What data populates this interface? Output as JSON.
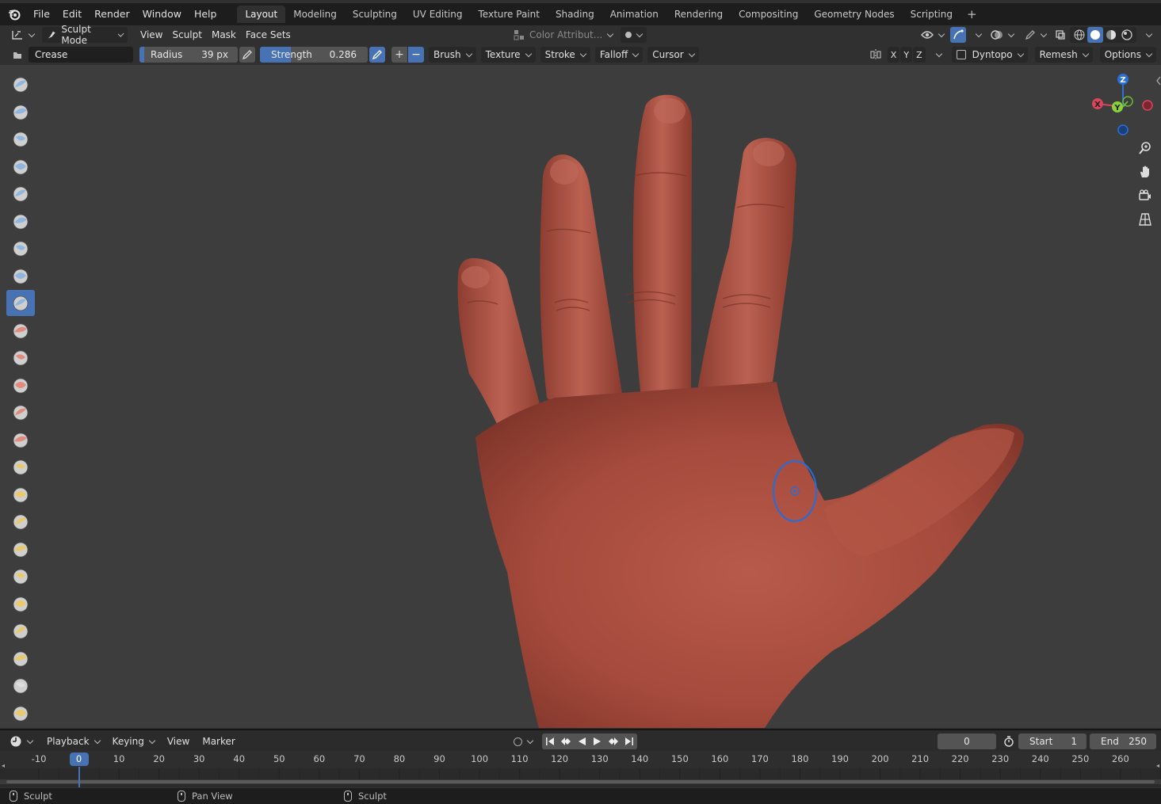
{
  "topbar": {
    "menus": [
      "File",
      "Edit",
      "Render",
      "Window",
      "Help"
    ],
    "workspaces": [
      "Layout",
      "Modeling",
      "Sculpting",
      "UV Editing",
      "Texture Paint",
      "Shading",
      "Animation",
      "Rendering",
      "Compositing",
      "Geometry Nodes",
      "Scripting"
    ],
    "add_label": "+"
  },
  "header": {
    "mode": "Sculpt Mode",
    "menus": [
      "View",
      "Sculpt",
      "Mask",
      "Face Sets"
    ],
    "color_attribute": "Color Attribut..."
  },
  "tool_settings": {
    "brush_name": "Crease",
    "radius_label": "Radius",
    "radius_value": "39 px",
    "strength_label": "Strength",
    "strength_value": "0.286",
    "strength_fraction": 0.286,
    "plus": "+",
    "minus": "−",
    "dropdowns": [
      "Brush",
      "Texture",
      "Stroke",
      "Falloff",
      "Cursor"
    ],
    "axes": [
      "X",
      "Y",
      "Z"
    ],
    "dyntopo": "Dyntopo",
    "remesh": "Remesh",
    "options": "Options"
  },
  "gizmo": {
    "z": "Z",
    "x": "X",
    "y": "Y"
  },
  "tools": [
    {
      "name": "draw",
      "color": "#8fb6df"
    },
    {
      "name": "draw-sharp",
      "color": "#8fb6df"
    },
    {
      "name": "clay",
      "color": "#8fb6df"
    },
    {
      "name": "clay-strips",
      "color": "#8fb6df"
    },
    {
      "name": "clay-thumb",
      "color": "#8fb6df"
    },
    {
      "name": "layer",
      "color": "#8fb6df"
    },
    {
      "name": "inflate",
      "color": "#8fb6df"
    },
    {
      "name": "blob",
      "color": "#8fb6df"
    },
    {
      "name": "crease",
      "color": "#8fb6df"
    },
    {
      "name": "smooth",
      "color": "#e28a7c"
    },
    {
      "name": "flatten",
      "color": "#e28a7c"
    },
    {
      "name": "fill",
      "color": "#e28a7c"
    },
    {
      "name": "scrape",
      "color": "#e28a7c"
    },
    {
      "name": "multiplane-scrape",
      "color": "#e28a7c"
    },
    {
      "name": "pinch",
      "color": "#e9c96a"
    },
    {
      "name": "grab",
      "color": "#e9c96a"
    },
    {
      "name": "elastic-deform",
      "color": "#e9c96a"
    },
    {
      "name": "snake-hook",
      "color": "#e9c96a"
    },
    {
      "name": "thumb",
      "color": "#e9c96a"
    },
    {
      "name": "pose",
      "color": "#e9c96a"
    },
    {
      "name": "nudge",
      "color": "#e9c96a"
    },
    {
      "name": "rotate",
      "color": "#e9c96a"
    },
    {
      "name": "slide-relax",
      "color": "#dddddd"
    },
    {
      "name": "boundary",
      "color": "#e9c96a"
    }
  ],
  "timeline": {
    "menus": [
      "Playback",
      "Keying",
      "View",
      "Marker"
    ],
    "current_frame": "0",
    "start_label": "Start",
    "start_value": "1",
    "end_label": "End",
    "end_value": "250",
    "ticks": [
      "-10",
      "0",
      "10",
      "20",
      "30",
      "40",
      "50",
      "60",
      "70",
      "80",
      "90",
      "100",
      "110",
      "120",
      "130",
      "140",
      "150",
      "160",
      "170",
      "180",
      "190",
      "200",
      "210",
      "220",
      "230",
      "240",
      "250",
      "260"
    ]
  },
  "status": {
    "left": "Sculpt",
    "middle": "Pan View",
    "right": "Sculpt"
  },
  "colors": {
    "accent": "#4772b3",
    "skin": "#a8483b",
    "viewport": "#3d3d3d",
    "brush_circle": "#1f6fe0"
  }
}
